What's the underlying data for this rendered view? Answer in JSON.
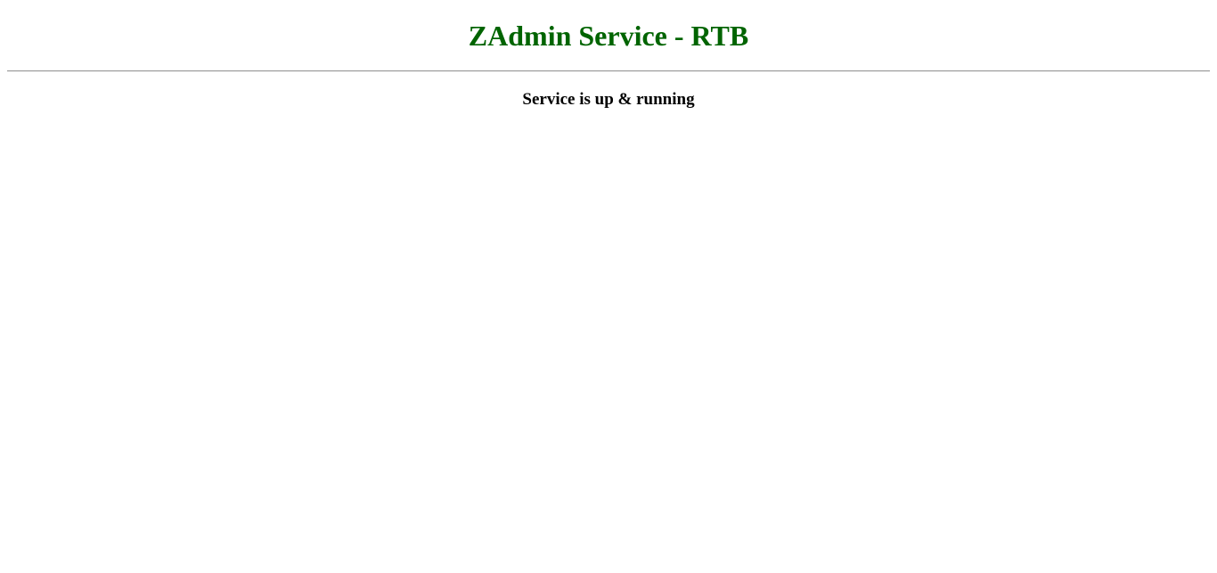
{
  "header": {
    "title": "ZAdmin Service - RTB"
  },
  "main": {
    "status_message": "Service is up & running"
  },
  "colors": {
    "title": "#006400",
    "status_text": "#000000",
    "divider": "#9a9a9a",
    "background": "#ffffff"
  }
}
